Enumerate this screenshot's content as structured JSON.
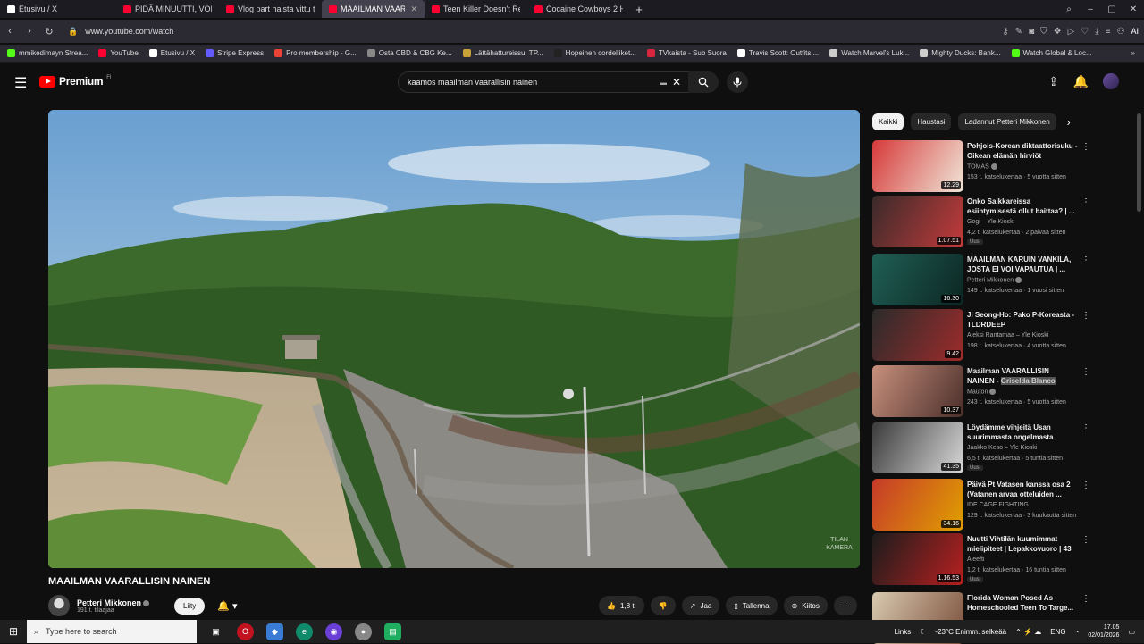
{
  "browser": {
    "tabs": [
      {
        "label": "Etusivu / X",
        "color": "#ffffff",
        "active": false
      },
      {
        "label": "PIDÄ MINUUTTI, VOITA 20",
        "color": "#ff0033",
        "active": false
      },
      {
        "label": "Vlog part haista vittu täll",
        "color": "#ff0033",
        "active": false
      },
      {
        "label": "MAAILMAN VAARALL",
        "color": "#ff0033",
        "active": true
      },
      {
        "label": "Teen Killer Doesn't Realiz",
        "color": "#ff0033",
        "active": false
      },
      {
        "label": "Cocaine Cowboys 2 Hust",
        "color": "#ff0033",
        "active": false
      }
    ],
    "url": "www.youtube.com/watch",
    "ai_label": "AI",
    "bookmarks": [
      {
        "label": "mmikedimayn Strea...",
        "color": "#53fc18"
      },
      {
        "label": "YouTube",
        "color": "#ff0033"
      },
      {
        "label": "Etusivu / X",
        "color": "#ffffff"
      },
      {
        "label": "Stripe Express",
        "color": "#635bff"
      },
      {
        "label": "Pro membership - G...",
        "color": "#ea4335"
      },
      {
        "label": "Osta CBD & CBG Ke...",
        "color": "#888888"
      },
      {
        "label": "Lättähattureissu: TP...",
        "color": "#c8a13a"
      },
      {
        "label": "Hopeinen cordelliket...",
        "color": "#222222"
      },
      {
        "label": "TVkaista - Sub Suora",
        "color": "#d7263d"
      },
      {
        "label": "Travis Scott: Outfits,...",
        "color": "#ffffff"
      },
      {
        "label": "Watch Marvel's Luk...",
        "color": "#cccccc"
      },
      {
        "label": "Mighty Ducks: Bank...",
        "color": "#cccccc"
      },
      {
        "label": "Watch Global & Loc...",
        "color": "#53fc18"
      }
    ]
  },
  "youtube": {
    "logo_text": "Premium",
    "logo_country": "FI",
    "search_query": "kaamos maailman vaarallisin nainen",
    "video_title": "MAAILMAN VAARALLISIN NAINEN",
    "watermark": "TILAN KAMERA",
    "channel_name": "Petteri Mikkonen",
    "subscribers": "191 t. tilaajaa",
    "join_label": "Liity",
    "likes": "1,8 t.",
    "share_label": "Jaa",
    "save_label": "Tallenna",
    "thanks_label": "Kiitos",
    "chips": [
      "Kaikki",
      "Haustasi",
      "Ladannut Petteri Mikkonen"
    ],
    "recommendations": [
      {
        "title": "Pohjois-Korean diktaattorisuku - Oikean elämän hirviöt",
        "channel": "TOMAS",
        "verified": true,
        "meta": "153 t. katselukertaa · 5 vuotta sitten",
        "duration": "12.29",
        "badge": "",
        "c1": "#d63a3a",
        "c2": "#f0e6d8"
      },
      {
        "title": "Onko Saikkareissa esiintymisestä ollut haittaa? | ...",
        "channel": "Gogi – Yle Kioski",
        "verified": false,
        "meta": "4,2 t. katselukertaa · 2 päivää sitten",
        "duration": "1.07.51",
        "badge": "Uusi",
        "c1": "#3a2a2a",
        "c2": "#c43b3b"
      },
      {
        "title": "MAAILMAN KARUIN VANKILA, JOSTA EI VOI VAPAUTUA | ...",
        "channel": "Petteri Mikkonen",
        "verified": true,
        "meta": "149 t. katselukertaa · 1 vuosi sitten",
        "duration": "16.30",
        "badge": "",
        "c1": "#1f5f55",
        "c2": "#0c2622"
      },
      {
        "title": "Ji Seong-Ho: Pako P-Koreasta - TLDRDEEP",
        "channel": "Aleksi Rantamaa – Yle Kioski",
        "verified": false,
        "meta": "198 t. katselukertaa · 4 vuotta sitten",
        "duration": "9.42",
        "badge": "",
        "c1": "#2b2b2b",
        "c2": "#9e2b2b"
      },
      {
        "title": "Maailman VAARALLISIN NAINEN - Griselda Blanco",
        "channel": "Mauton",
        "verified": true,
        "meta": "243 t. katselukertaa · 5 vuotta sitten",
        "duration": "10.37",
        "badge": "",
        "c1": "#c78f7c",
        "c2": "#4a2e2a"
      },
      {
        "title": "Löydämme vihjeitä Usan suurimmasta ongelmasta",
        "channel": "Jaakko Keso – Yle Kioski",
        "verified": false,
        "meta": "6,5 t. katselukertaa · 5 tuntia sitten",
        "duration": "41.35",
        "badge": "Uusi",
        "c1": "#3a3a3a",
        "c2": "#d9d9d9"
      },
      {
        "title": "Päivä Pt Vatasen kanssa osa 2 (Vatanen arvaa otteluiden ...",
        "channel": "IDE CAGE FIGHTING",
        "verified": false,
        "meta": "129 t. katselukertaa · 3 kuukautta sitten",
        "duration": "34.16",
        "badge": "",
        "c1": "#c63a2a",
        "c2": "#e0a000"
      },
      {
        "title": "Nuutti Vihtilän kuumimmat mielipiteet | Lepakkovuoro | 43",
        "channel": "Aleefti",
        "verified": false,
        "meta": "1,2 t. katselukertaa · 16 tuntia sitten",
        "duration": "1.16.53",
        "badge": "Uusi",
        "c1": "#1c1c1c",
        "c2": "#b82020"
      },
      {
        "title": "Florida Woman Posed As Homeschooled Teen To Targe...",
        "channel": "",
        "verified": false,
        "meta": "",
        "duration": "",
        "badge": "",
        "c1": "#d9c9b0",
        "c2": "#7a4e3a"
      }
    ],
    "highlight_text": "Griselda Blanco"
  },
  "taskbar": {
    "search_placeholder": "Type here to search",
    "links_label": "Links",
    "weather": "-23°C Enimm. selkeää",
    "language": "ENG",
    "time": "17.05",
    "date": "02/01/2026"
  }
}
